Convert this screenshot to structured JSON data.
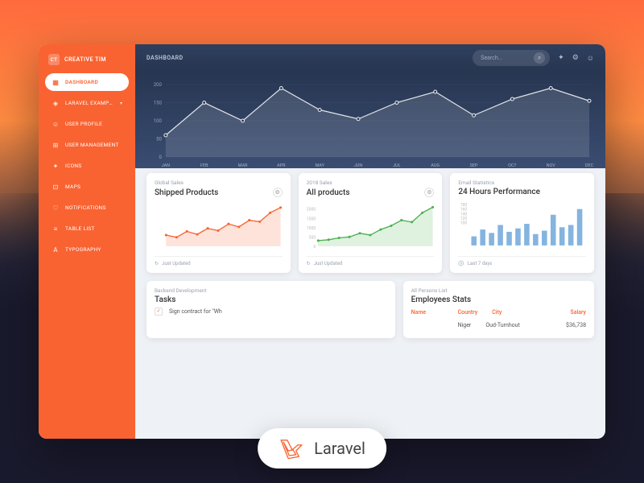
{
  "brand": {
    "badge": "CT",
    "name": "CREATIVE TIM"
  },
  "sidebar": {
    "items": [
      {
        "label": "DASHBOARD",
        "icon": "▦"
      },
      {
        "label": "LARAVEL EXAMPLES",
        "icon": "◈",
        "caret": "▾"
      },
      {
        "label": "USER PROFILE",
        "icon": "☺"
      },
      {
        "label": "USER MANAGEMENT",
        "icon": "⊞"
      },
      {
        "label": "ICONS",
        "icon": "✦"
      },
      {
        "label": "MAPS",
        "icon": "⊡"
      },
      {
        "label": "NOTIFICATIONS",
        "icon": "♡"
      },
      {
        "label": "TABLE LIST",
        "icon": "≡"
      },
      {
        "label": "TYPOGRAPHY",
        "icon": "A"
      }
    ]
  },
  "topbar": {
    "title": "DASHBOARD",
    "search_placeholder": "Search..."
  },
  "hero_chart": {
    "type": "line-area",
    "y_ticks": [
      0,
      50,
      100,
      150,
      200
    ],
    "categories": [
      "JAN",
      "FEB",
      "MAR",
      "APR",
      "MAY",
      "JUN",
      "JUL",
      "AUG",
      "SEP",
      "OCT",
      "NOV",
      "DEC"
    ],
    "values": [
      60,
      150,
      100,
      190,
      130,
      105,
      150,
      180,
      115,
      160,
      190,
      155
    ]
  },
  "cards": [
    {
      "sub": "Global Sales",
      "title": "Shipped Products",
      "foot_icon": "↻",
      "foot": "Just Updated",
      "gear": true,
      "chart": {
        "type": "line-area",
        "color": "#f96332",
        "values": [
          150,
          120,
          200,
          160,
          240,
          210,
          300,
          260,
          350,
          330,
          450,
          520
        ],
        "ylim": [
          0,
          550
        ]
      }
    },
    {
      "sub": "2018 Sales",
      "title": "All products",
      "foot_icon": "↻",
      "foot": "Just Updated",
      "gear": true,
      "chart": {
        "type": "line-area",
        "color": "#4caf50",
        "values": [
          300,
          350,
          450,
          500,
          700,
          600,
          900,
          1100,
          1400,
          1300,
          1800,
          2100
        ],
        "ylim": [
          0,
          2200
        ],
        "y_ticks": [
          0,
          500,
          1000,
          1500,
          2000
        ]
      }
    },
    {
      "sub": "Email Statistics",
      "title": "24 Hours Performance",
      "foot_icon": "🕓",
      "foot": "Last 7 days",
      "gear": false,
      "chart": {
        "type": "bar",
        "color": "#5b9bd5",
        "values": [
          40,
          70,
          55,
          90,
          60,
          75,
          95,
          50,
          65,
          135,
          80,
          90,
          160
        ],
        "ylim": [
          0,
          180
        ],
        "y_ticks": [
          100,
          120,
          140,
          160,
          180
        ]
      }
    }
  ],
  "tasks": {
    "sub": "Backend Development",
    "title": "Tasks",
    "rows": [
      {
        "checked": true,
        "text": "Sign contract for \"Wh"
      }
    ]
  },
  "employees": {
    "sub": "All Persons List",
    "title": "Employees Stats",
    "columns": [
      "Name",
      "Country",
      "City",
      "Salary"
    ],
    "rows": [
      {
        "name": "",
        "country": "Niger",
        "city": "Oud-Turnhout",
        "salary": "$36,738"
      }
    ]
  },
  "badge": {
    "text": "Laravel"
  }
}
